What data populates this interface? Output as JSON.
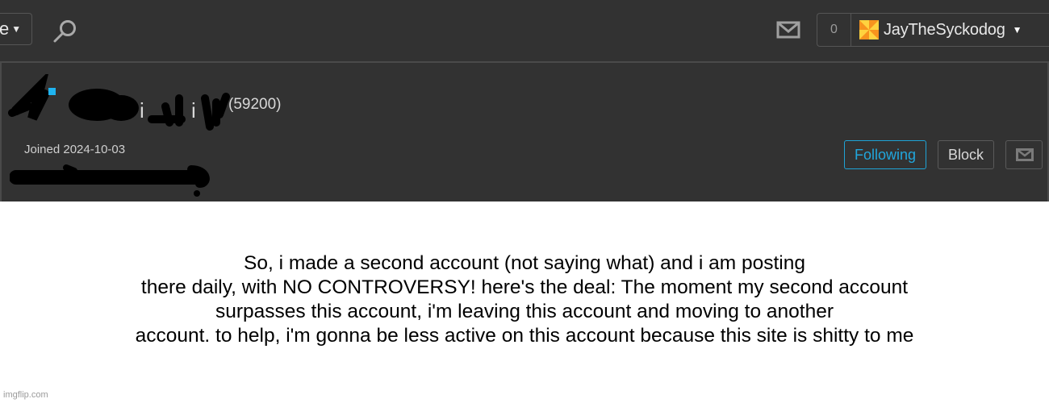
{
  "topbar": {
    "nav_dropdown_label": "e",
    "search_icon": "search-icon",
    "mail_icon": "mail-icon",
    "notification_count": "0",
    "username": "JayTheSyckodog",
    "avatar_colors": [
      "#f7931e",
      "#ffd23f"
    ]
  },
  "profile": {
    "points": "(59200)",
    "joined": "Joined 2024-10-03",
    "name_redacted": true,
    "bio_redacted": true,
    "buttons": {
      "following": "Following",
      "block": "Block",
      "message_icon": "mail-icon"
    },
    "accent_color": "#21a6dc"
  },
  "meme": {
    "lines": [
      "So, i made a second account (not saying what) and i am posting",
      "there daily, with NO CONTROVERSY! here's the deal: The moment my second account",
      "surpasses this account, i'm leaving this account and moving to another",
      "account. to help, i'm gonna be less active on this account because this site is shitty to me"
    ],
    "watermark": "imgflip.com"
  }
}
